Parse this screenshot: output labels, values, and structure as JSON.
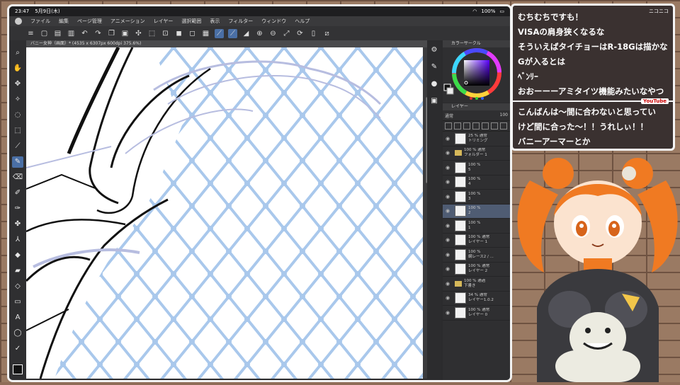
{
  "status": {
    "time": "23:47",
    "date": "5月9日(木)",
    "battery": "100%"
  },
  "menu": [
    "ファイル",
    "編集",
    "ページ管理",
    "アニメーション",
    "レイヤー",
    "選択範囲",
    "表示",
    "フィルター",
    "ウィンドウ",
    "ヘルプ"
  ],
  "doc_tab": "バニー女神（画面）* (4535 x 6307px 600dpi 375.6%)",
  "panels": {
    "color_title": "カラーサークル",
    "layer_title": "レイヤー",
    "blend_mode": "通常",
    "opacity": "100"
  },
  "layers": [
    {
      "line1": "25 % 通常",
      "line2": "トリミング",
      "type": "thumb",
      "selected": false
    },
    {
      "line1": "100 % 通常",
      "line2": "フォルダー 1",
      "type": "folder",
      "selected": false
    },
    {
      "line1": "100 %",
      "line2": "5",
      "type": "thumb",
      "selected": false
    },
    {
      "line1": "100 %",
      "line2": "4",
      "type": "thumb",
      "selected": false
    },
    {
      "line1": "100 %",
      "line2": "3",
      "type": "thumb",
      "selected": false
    },
    {
      "line1": "100 %",
      "line2": "2",
      "type": "thumb",
      "selected": true
    },
    {
      "line1": "100 %",
      "line2": "1",
      "type": "thumb",
      "selected": false
    },
    {
      "line1": "100 % 通常",
      "line2": "レイヤー 1",
      "type": "thumb",
      "selected": false
    },
    {
      "line1": "100 %",
      "line2": "網レース2 / ...",
      "type": "thumb",
      "selected": false
    },
    {
      "line1": "100 % 通常",
      "line2": "レイヤー 2",
      "type": "thumb",
      "selected": false
    },
    {
      "line1": "100 % 通過",
      "line2": "下書き",
      "type": "folder",
      "selected": false
    },
    {
      "line1": "34 % 通常",
      "line2": "レイヤー1.0.2",
      "type": "thumb",
      "selected": false
    },
    {
      "line1": "100 % 通常",
      "line2": "レイヤー 0",
      "type": "thumb",
      "selected": false
    }
  ],
  "comments": {
    "nico_label": "ニコニコ",
    "nico": [
      "むちむちですも！",
      "VISAの肩身狭くなるな",
      "そういえばタイチョーはR-18Gは描かな",
      "Gが入るとは",
      "ﾍﾞﾝﾘｰ",
      "おおーーーアミタイツ機能みたいなやつ"
    ],
    "youtube_label": "YouTube",
    "youtube": [
      "こんばんは〜間に合わないと思ってい",
      "けど間に合った〜！！うれしぃ！！",
      "バニーアーマーとか"
    ]
  },
  "colors": {
    "net": "#a9c8ec",
    "accent": "#4a6fa5",
    "hair": "#f07a22"
  }
}
